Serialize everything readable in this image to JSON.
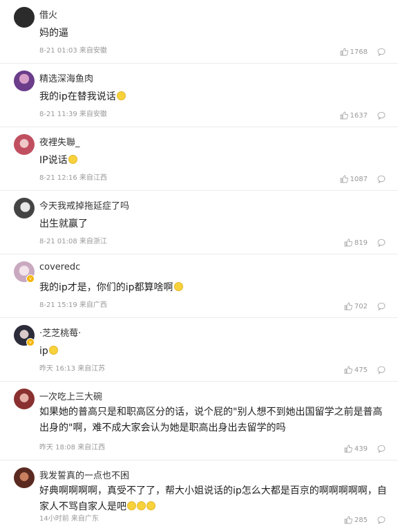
{
  "comments": [
    {
      "user": "借火",
      "text": "妈的逼",
      "time": "8-21 01:03",
      "location": "来自安徽",
      "likes": "1768",
      "avatar_color": "#2b2b2b"
    },
    {
      "user": "精选深海鱼肉",
      "text": "我的ip在替我说话",
      "time": "8-21 11:39",
      "location": "来自安徽",
      "likes": "1637",
      "avatar_color": "#6b3d8a"
    },
    {
      "user": "夜裡失聯_",
      "text": "IP说话",
      "time": "8-21 12:16",
      "location": "来自江西",
      "likes": "1087",
      "avatar_color": "#c05060"
    },
    {
      "user": "今天我戒掉拖延症了吗",
      "text": "出生就赢了",
      "time": "8-21 01:08",
      "location": "来自浙江",
      "likes": "819",
      "avatar_color": "#444444"
    },
    {
      "user": "coveredc",
      "text": "我的ip才是，你们的ip都算啥啊",
      "time": "8-21 15:19",
      "location": "来自广西",
      "likes": "702",
      "avatar_color": "#c9a9c0"
    },
    {
      "user": "·芝芝桃莓·",
      "text": "ip",
      "time": "昨天 16:13",
      "location": "来自江苏",
      "likes": "475",
      "avatar_color": "#2c2c3a"
    },
    {
      "user": "一次吃上三大碗",
      "text": "如果她的普高只是和职高区分的话，说个屁的\"别人想不到她出国留学之前是普高出身的\"啊，难不成大家会认为她是职高出身出去留学的吗",
      "time": "昨天 18:08",
      "location": "来自江西",
      "likes": "439",
      "avatar_color": "#8a3030"
    },
    {
      "user": "我发誓真的一点也不困",
      "text": "好典啊啊啊啊，真受不了了，帮大小姐说话的ip怎么大都是百京的啊啊啊啊啊，自家人不骂自家人是吧",
      "time": "14小时前",
      "location": "来自广东",
      "likes": "285",
      "avatar_color": "#5a2a20"
    }
  ]
}
